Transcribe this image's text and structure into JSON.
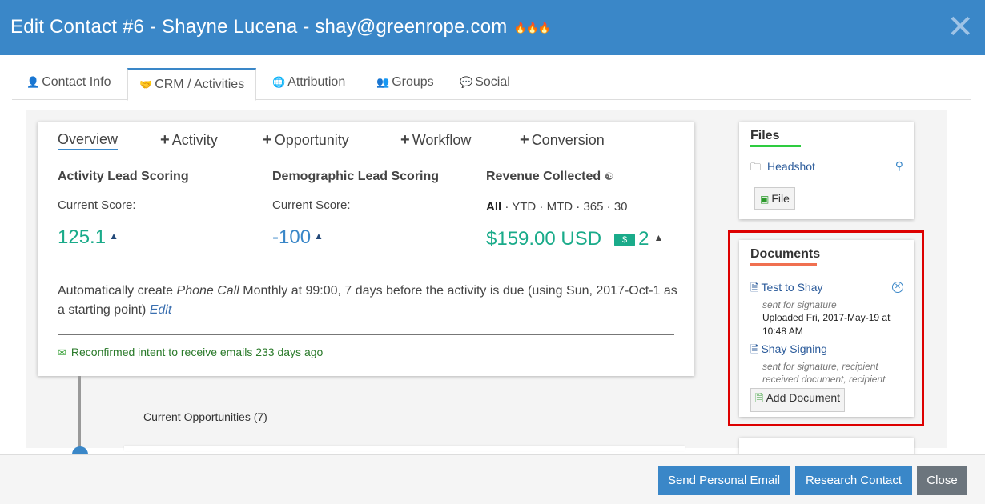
{
  "header": {
    "title": "Edit Contact #6 - Shayne Lucena - shay@greenrope.com",
    "flames": "🔥🔥🔥",
    "close_symbol": "✕"
  },
  "tabs": [
    {
      "label": "Contact Info",
      "icon": "person-icon",
      "glyph": "👤",
      "active": false
    },
    {
      "label": "CRM / Activities",
      "icon": "handshake-icon",
      "glyph": "🤝",
      "active": true
    },
    {
      "label": "Attribution",
      "icon": "globe-icon",
      "glyph": "🌐",
      "active": false
    },
    {
      "label": "Groups",
      "icon": "people-icon",
      "glyph": "👥",
      "active": false
    },
    {
      "label": "Social",
      "icon": "speech-bubble-icon",
      "glyph": "💬",
      "active": false
    }
  ],
  "subtabs": {
    "overview": "Overview",
    "activity": "Activity",
    "opportunity": "Opportunity",
    "workflow": "Workflow",
    "conversion": "Conversion",
    "plus": "+"
  },
  "activity_scoring": {
    "title": "Activity Lead Scoring",
    "sub": "Current Score:",
    "value": "125.1"
  },
  "demographic_scoring": {
    "title": "Demographic Lead Scoring",
    "sub": "Current Score:",
    "value": "-100"
  },
  "revenue": {
    "title": "Revenue Collected",
    "periods": {
      "all": "All",
      "ytd": "YTD",
      "mtd": "MTD",
      "d365": "365",
      "d30": "30",
      "sep": "·"
    },
    "amount": "$159.00 USD",
    "count": "2"
  },
  "auto_create": {
    "prefix": "Automatically create ",
    "activity_type": "Phone Call",
    "rest": " Monthly at 99:00, 7 days before the activity is due (using Sun, 2017-Oct-1 as a starting point) ",
    "edit_label": "Edit"
  },
  "confirmation": "Reconfirmed intent to receive emails 233 days ago",
  "opportunities_title": "Current Opportunities (7)",
  "files": {
    "title": "Files",
    "folder": "Headshot",
    "button": "File"
  },
  "documents": {
    "title": "Documents",
    "items": [
      {
        "name": "Test to Shay",
        "note": "sent for signature",
        "uploaded": "Uploaded Fri, 2017-May-19 at 10:48 AM"
      },
      {
        "name": "Shay Signing",
        "note": "sent for signature, recipient received document, recipient"
      }
    ],
    "add_button": "Add Document"
  },
  "footer": {
    "send_email": "Send Personal Email",
    "research": "Research Contact",
    "close": "Close"
  },
  "colors": {
    "header_blue": "#3a87c8",
    "score_teal": "#1aab8a",
    "highlight_red": "#dd0000"
  }
}
